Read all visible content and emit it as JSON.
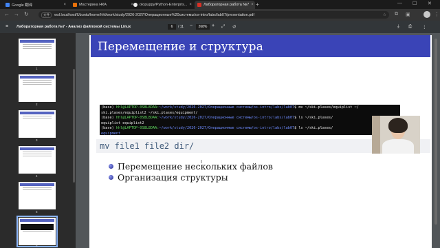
{
  "tabs": [
    {
      "title": "Google 翻译",
      "favicon_color": "#4285f4",
      "active": false
    },
    {
      "title": "Мастерика НКА",
      "favicon_color": "#e8710a",
      "active": false
    },
    {
      "title": "olopuppy/Python-Enterpris...",
      "favicon_color": "#f0f0f0",
      "active": false
    },
    {
      "title": "Лабораторная работа №7",
      "favicon_color": "#d93025",
      "active": true
    }
  ],
  "address": {
    "badge": "文件",
    "url": "wsl.localhost/Ubuntu/home/hhl/work/study/2026-2027/Операционные%20системы/os-intro/labs/lab07/presentation.pdf"
  },
  "pdf_toolbar": {
    "title": "Лабораторная работа №7 - Анализ файловой системы Linux",
    "page_current": "6",
    "page_total": "/ 11",
    "zoom": "268%"
  },
  "thumbnails": [
    "1",
    "2",
    "3",
    "4",
    "5",
    "6"
  ],
  "slide": {
    "title": "Перемещение и структура",
    "terminal": [
      {
        "prompt": "(base) ",
        "user": "hhl@LAPTOP-0S8L8DAA:",
        "path": "~/work/study/2026-2027/Операционные системы/os-intro/labs/lab07",
        "cmd": "$ mv ~/ski.plases/equiplist ~/"
      },
      {
        "prompt": "",
        "user": "",
        "path": "",
        "cmd": "ski.plases/equiplist2 ~/ski.plases/equipment/"
      },
      {
        "prompt": "(base) ",
        "user": "hhl@LAPTOP-0S8L8DAA:",
        "path": "~/work/study/2026-2027/Операционные системы/os-intro/labs/lab07",
        "cmd": "$ ls ~/ski.plases/"
      },
      {
        "prompt": "",
        "user": "",
        "path": "",
        "cmd": "equiplist  equiplist2"
      },
      {
        "prompt": "(base) ",
        "user": "hhl@LAPTOP-0S8L8DAA:",
        "path": "~/work/study/2026-2027/Операционные системы/os-intro/labs/lab07",
        "cmd": "$ ls ~/ski.plases/"
      },
      {
        "prompt": "",
        "user": "",
        "path": "equipment",
        "cmd": ""
      }
    ],
    "code": "mv file1 file2 dir/",
    "bullets": [
      "Перемещение нескольких файлов",
      "Организация структуры"
    ]
  }
}
